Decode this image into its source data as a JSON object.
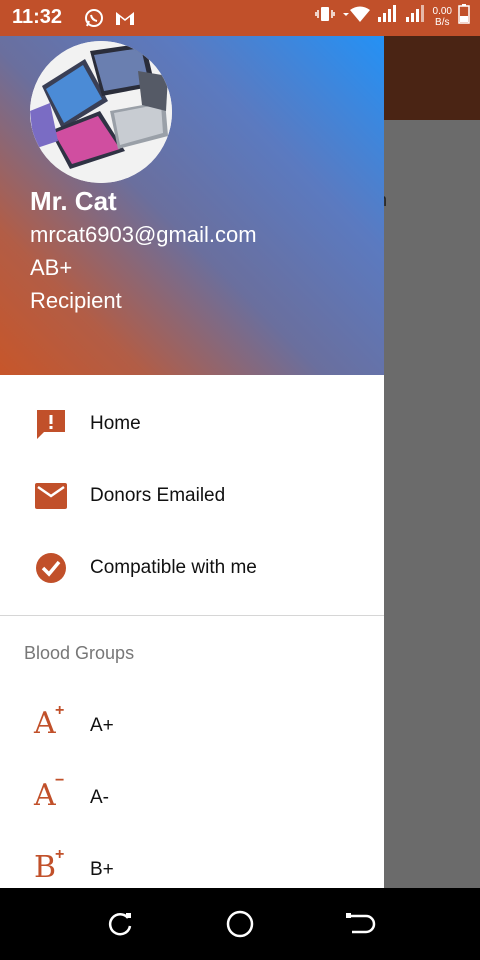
{
  "status_bar": {
    "time": "11:32",
    "net_speed_value": "0.00",
    "net_speed_unit": "B/s"
  },
  "drawer": {
    "header": {
      "name": "Mr. Cat",
      "email": "mrcat6903@gmail.com",
      "blood_group": "AB+",
      "role": "Recipient"
    },
    "menu": [
      {
        "label": "Home",
        "icon": "alert-message-icon"
      },
      {
        "label": "Donors Emailed",
        "icon": "mail-icon"
      },
      {
        "label": "Compatible with me",
        "icon": "check-circle-icon"
      }
    ],
    "section_title": "Blood Groups",
    "blood_groups": [
      {
        "label": "A+",
        "letter": "A",
        "sign": "+"
      },
      {
        "label": "A-",
        "letter": "A",
        "sign": "−"
      },
      {
        "label": "B+",
        "letter": "B",
        "sign": "+"
      }
    ]
  },
  "background_app": {
    "partial_char": "n"
  },
  "colors": {
    "accent": "#c1502a",
    "status_bar": "#c1502a",
    "scrim": "#6b6b6b"
  }
}
